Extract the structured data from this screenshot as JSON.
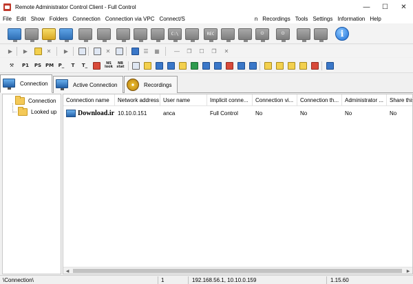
{
  "window": {
    "title": "Remote Administrator Control Client - Full Control",
    "minimize_glyph": "—",
    "maximize_glyph": "☐",
    "close_glyph": "✕"
  },
  "menu": [
    "File",
    "Edit",
    "Show",
    "Folders",
    "Connection",
    "Connection via VPC",
    "Connect/S",
    "n",
    "Recordings",
    "Tools",
    "Settings",
    "Information",
    "Help"
  ],
  "toolbar1": {
    "labels": {
      "cmd": "C:\\",
      "rec": "REC",
      "power": "⏻",
      "info": "i"
    }
  },
  "toolbar3": {
    "labels": [
      "P1",
      "PS",
      "PM",
      "P_",
      "T",
      "T_",
      "NS look",
      "NB stat"
    ]
  },
  "tabs": [
    {
      "label": "Connection",
      "active": true
    },
    {
      "label": "Active Connection",
      "active": false
    },
    {
      "label": "Recordings",
      "active": false
    }
  ],
  "tree": [
    {
      "label": "Connection"
    },
    {
      "label": "Looked up"
    }
  ],
  "table": {
    "columns": [
      "Connection name",
      "Network address",
      "User name",
      "Implicit conne...",
      "Connection vi...",
      "Connection th...",
      "Administrator ...",
      "Share this"
    ],
    "rows": [
      [
        "Download.ir",
        "10.10.0.151",
        "anca",
        "Full Control",
        "No",
        "No",
        "No",
        "No"
      ]
    ]
  },
  "status": {
    "path": "\\Connection\\",
    "count": "1",
    "addresses": "192.168.56.1, 10.10.0.159",
    "version": "1.15.60"
  }
}
